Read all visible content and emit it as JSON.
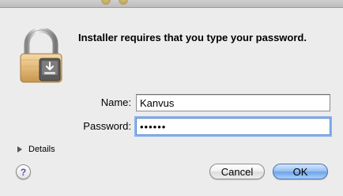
{
  "dialog": {
    "message": "Installer requires that you type your password."
  },
  "form": {
    "name_label": "Name:",
    "name_value": "Kanvus",
    "password_label": "Password:",
    "password_value": "••••••"
  },
  "details": {
    "label": "Details"
  },
  "help": {
    "label": "?"
  },
  "buttons": {
    "cancel_label": "Cancel",
    "ok_label": "OK"
  },
  "icons": {
    "lock": "lock-icon",
    "disclosure": "disclosure-triangle-icon",
    "help": "help-icon"
  },
  "colors": {
    "background": "#ececec",
    "focus_ring": "#8ab3ea",
    "default_button": "#6fa4e8"
  }
}
